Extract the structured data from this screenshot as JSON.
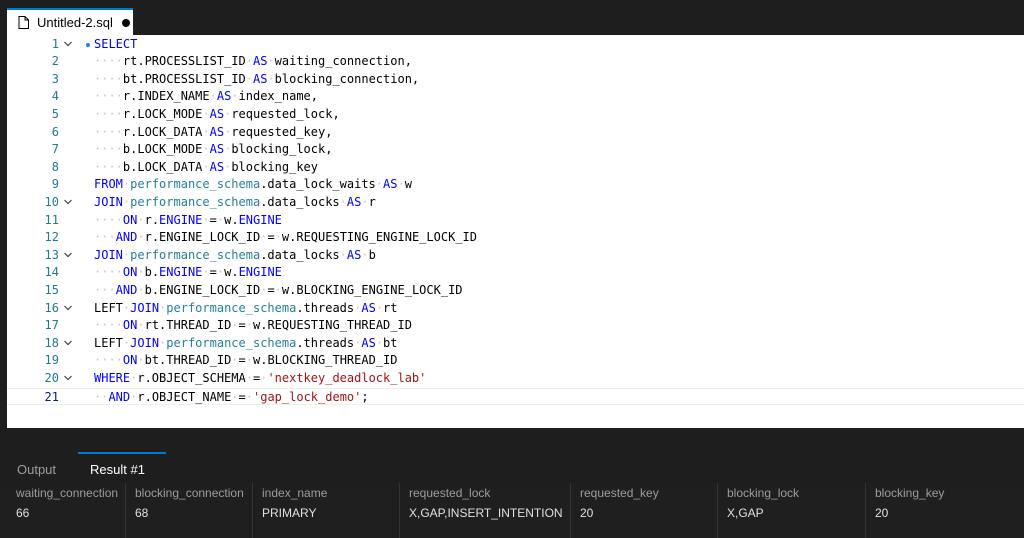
{
  "tab": {
    "title": "Untitled-2.sql"
  },
  "panel": {
    "output_label": "Output",
    "result_label": "Result #1"
  },
  "results": {
    "columns": [
      "waiting_connection",
      "blocking_connection",
      "index_name",
      "requested_lock",
      "requested_key",
      "blocking_lock",
      "blocking_key"
    ],
    "rows": [
      [
        "66",
        "68",
        "PRIMARY",
        "X,GAP,INSERT_INTENTION",
        "20",
        "X,GAP",
        "20"
      ]
    ]
  },
  "editor": {
    "lines": [
      {
        "n": "1",
        "fold": true,
        "t": [
          [
            "kw",
            "SELECT"
          ]
        ]
      },
      {
        "n": "2",
        "t": [
          [
            "ws",
            "····"
          ],
          [
            "",
            "rt.PROCESSLIST_ID"
          ],
          [
            "ws",
            "·"
          ],
          [
            "kw",
            "AS"
          ],
          [
            "ws",
            "·"
          ],
          [
            "",
            "waiting_connection,"
          ]
        ]
      },
      {
        "n": "3",
        "t": [
          [
            "ws",
            "····"
          ],
          [
            "",
            "bt.PROCESSLIST_ID"
          ],
          [
            "ws",
            "·"
          ],
          [
            "kw",
            "AS"
          ],
          [
            "ws",
            "·"
          ],
          [
            "",
            "blocking_connection,"
          ]
        ]
      },
      {
        "n": "4",
        "t": [
          [
            "ws",
            "····"
          ],
          [
            "",
            "r.INDEX_NAME"
          ],
          [
            "ws",
            "·"
          ],
          [
            "kw",
            "AS"
          ],
          [
            "ws",
            "·"
          ],
          [
            "",
            "index_name,"
          ]
        ]
      },
      {
        "n": "5",
        "t": [
          [
            "ws",
            "····"
          ],
          [
            "",
            "r.LOCK_MODE"
          ],
          [
            "ws",
            "·"
          ],
          [
            "kw",
            "AS"
          ],
          [
            "ws",
            "·"
          ],
          [
            "",
            "requested_lock,"
          ]
        ]
      },
      {
        "n": "6",
        "t": [
          [
            "ws",
            "····"
          ],
          [
            "",
            "r.LOCK_DATA"
          ],
          [
            "ws",
            "·"
          ],
          [
            "kw",
            "AS"
          ],
          [
            "ws",
            "·"
          ],
          [
            "",
            "requested_key,"
          ]
        ]
      },
      {
        "n": "7",
        "t": [
          [
            "ws",
            "····"
          ],
          [
            "",
            "b.LOCK_MODE"
          ],
          [
            "ws",
            "·"
          ],
          [
            "kw",
            "AS"
          ],
          [
            "ws",
            "·"
          ],
          [
            "",
            "blocking_lock,"
          ]
        ]
      },
      {
        "n": "8",
        "t": [
          [
            "ws",
            "····"
          ],
          [
            "",
            "b.LOCK_DATA"
          ],
          [
            "ws",
            "·"
          ],
          [
            "kw",
            "AS"
          ],
          [
            "ws",
            "·"
          ],
          [
            "",
            "blocking_key"
          ]
        ]
      },
      {
        "n": "9",
        "t": [
          [
            "kw",
            "FROM"
          ],
          [
            "ws",
            "·"
          ],
          [
            "obj",
            "performance_schema"
          ],
          [
            "",
            ".data_lock_waits"
          ],
          [
            "ws",
            "·"
          ],
          [
            "kw",
            "AS"
          ],
          [
            "ws",
            "·"
          ],
          [
            "",
            "w"
          ]
        ]
      },
      {
        "n": "10",
        "fold": true,
        "t": [
          [
            "kw",
            "JOIN"
          ],
          [
            "ws",
            "·"
          ],
          [
            "obj",
            "performance_schema"
          ],
          [
            "",
            ".data_locks"
          ],
          [
            "ws",
            "·"
          ],
          [
            "kw",
            "AS"
          ],
          [
            "ws",
            "·"
          ],
          [
            "",
            "r"
          ]
        ]
      },
      {
        "n": "11",
        "t": [
          [
            "ws",
            "····"
          ],
          [
            "kw",
            "ON"
          ],
          [
            "ws",
            "·"
          ],
          [
            "",
            "r."
          ],
          [
            "kw",
            "ENGINE"
          ],
          [
            "ws",
            "·"
          ],
          [
            "",
            "="
          ],
          [
            "ws",
            "·"
          ],
          [
            "",
            "w."
          ],
          [
            "kw",
            "ENGINE"
          ]
        ]
      },
      {
        "n": "12",
        "t": [
          [
            "ws",
            "···"
          ],
          [
            "kw",
            "AND"
          ],
          [
            "ws",
            "·"
          ],
          [
            "",
            "r.ENGINE_LOCK_ID"
          ],
          [
            "ws",
            "·"
          ],
          [
            "",
            "="
          ],
          [
            "ws",
            "·"
          ],
          [
            "",
            "w.REQUESTING_ENGINE_LOCK_ID"
          ]
        ]
      },
      {
        "n": "13",
        "fold": true,
        "t": [
          [
            "kw",
            "JOIN"
          ],
          [
            "ws",
            "·"
          ],
          [
            "obj",
            "performance_schema"
          ],
          [
            "",
            ".data_locks"
          ],
          [
            "ws",
            "·"
          ],
          [
            "kw",
            "AS"
          ],
          [
            "ws",
            "·"
          ],
          [
            "",
            "b"
          ]
        ]
      },
      {
        "n": "14",
        "t": [
          [
            "ws",
            "····"
          ],
          [
            "kw",
            "ON"
          ],
          [
            "ws",
            "·"
          ],
          [
            "",
            "b."
          ],
          [
            "kw",
            "ENGINE"
          ],
          [
            "ws",
            "·"
          ],
          [
            "",
            "="
          ],
          [
            "ws",
            "·"
          ],
          [
            "",
            "w."
          ],
          [
            "kw",
            "ENGINE"
          ]
        ]
      },
      {
        "n": "15",
        "t": [
          [
            "ws",
            "···"
          ],
          [
            "kw",
            "AND"
          ],
          [
            "ws",
            "·"
          ],
          [
            "",
            "b.ENGINE_LOCK_ID"
          ],
          [
            "ws",
            "·"
          ],
          [
            "",
            "="
          ],
          [
            "ws",
            "·"
          ],
          [
            "",
            "w.BLOCKING_ENGINE_LOCK_ID"
          ]
        ]
      },
      {
        "n": "16",
        "fold": true,
        "t": [
          [
            "",
            "LEFT"
          ],
          [
            "ws",
            "·"
          ],
          [
            "kw",
            "JOIN"
          ],
          [
            "ws",
            "·"
          ],
          [
            "obj",
            "performance_schema"
          ],
          [
            "",
            ".threads"
          ],
          [
            "ws",
            "·"
          ],
          [
            "kw",
            "AS"
          ],
          [
            "ws",
            "·"
          ],
          [
            "",
            "rt"
          ]
        ]
      },
      {
        "n": "17",
        "t": [
          [
            "ws",
            "····"
          ],
          [
            "kw",
            "ON"
          ],
          [
            "ws",
            "·"
          ],
          [
            "",
            "rt.THREAD_ID"
          ],
          [
            "ws",
            "·"
          ],
          [
            "",
            "="
          ],
          [
            "ws",
            "·"
          ],
          [
            "",
            "w.REQUESTING_THREAD_ID"
          ]
        ]
      },
      {
        "n": "18",
        "fold": true,
        "t": [
          [
            "",
            "LEFT"
          ],
          [
            "ws",
            "·"
          ],
          [
            "kw",
            "JOIN"
          ],
          [
            "ws",
            "·"
          ],
          [
            "obj",
            "performance_schema"
          ],
          [
            "",
            ".threads"
          ],
          [
            "ws",
            "·"
          ],
          [
            "kw",
            "AS"
          ],
          [
            "ws",
            "·"
          ],
          [
            "",
            "bt"
          ]
        ]
      },
      {
        "n": "19",
        "t": [
          [
            "ws",
            "····"
          ],
          [
            "kw",
            "ON"
          ],
          [
            "ws",
            "·"
          ],
          [
            "",
            "bt.THREAD_ID"
          ],
          [
            "ws",
            "·"
          ],
          [
            "",
            "="
          ],
          [
            "ws",
            "·"
          ],
          [
            "",
            "w.BLOCKING_THREAD_ID"
          ]
        ]
      },
      {
        "n": "20",
        "fold": true,
        "t": [
          [
            "kw",
            "WHERE"
          ],
          [
            "ws",
            "·"
          ],
          [
            "",
            "r.OBJECT_SCHEMA"
          ],
          [
            "ws",
            "·"
          ],
          [
            "",
            "="
          ],
          [
            "ws",
            "·"
          ],
          [
            "str",
            "'nextkey_deadlock_lab'"
          ]
        ]
      },
      {
        "n": "21",
        "current": true,
        "t": [
          [
            "ws",
            "··"
          ],
          [
            "kw",
            "AND"
          ],
          [
            "ws",
            "·"
          ],
          [
            "",
            "r.OBJECT_NAME"
          ],
          [
            "ws",
            "·"
          ],
          [
            "",
            "="
          ],
          [
            "ws",
            "·"
          ],
          [
            "str",
            "'gap_lock_demo'"
          ],
          [
            "",
            ";"
          ]
        ]
      }
    ]
  }
}
